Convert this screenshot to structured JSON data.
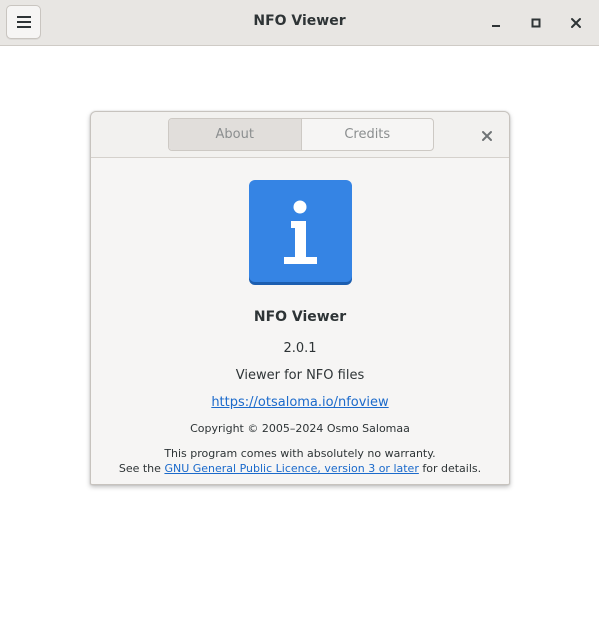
{
  "window": {
    "title": "NFO Viewer",
    "menu_icon": "hamburger-menu-icon",
    "controls": [
      "minimize-icon",
      "maximize-icon",
      "close-icon"
    ]
  },
  "about_dialog": {
    "tabs": [
      {
        "label": "About",
        "selected": true
      },
      {
        "label": "Credits",
        "selected": false
      }
    ],
    "close_icon": "close-icon",
    "app_icon": "info-icon",
    "app_icon_color": "#3584e4",
    "app_name": "NFO Viewer",
    "version": "2.0.1",
    "comments": "Viewer for NFO files",
    "website": "https://otsaloma.io/nfoview",
    "copyright": "Copyright © 2005–2024 Osmo Salomaa",
    "license": {
      "line1": "This program comes with absolutely no warranty.",
      "prefix": "See the ",
      "link": "GNU General Public Licence, version 3 or later",
      "suffix": " for details."
    }
  },
  "colors": {
    "link": "#1b6acb",
    "accent": "#3584e4"
  }
}
